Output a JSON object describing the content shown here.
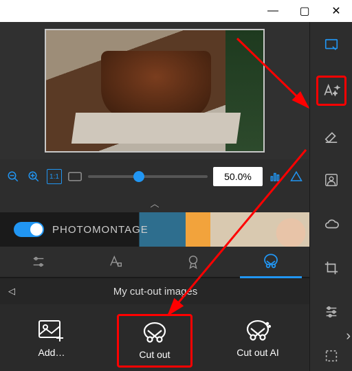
{
  "titlebar": {
    "min": "—",
    "max": "▢",
    "close": "✕"
  },
  "zoom": {
    "value": "50.0%"
  },
  "banner": {
    "label": "PHOTOMONTAGE"
  },
  "tabs": [
    {
      "name": "adjust-tab"
    },
    {
      "name": "text-tab"
    },
    {
      "name": "award-tab"
    },
    {
      "name": "cutout-tab"
    }
  ],
  "section": {
    "title": "My cut-out images"
  },
  "actions": {
    "add": "Add…",
    "cutout": "Cut out",
    "cutoutai": "Cut out AI"
  },
  "sidepanel_tools": [
    "edit",
    "text-stars",
    "eraser",
    "people",
    "cloud",
    "crop",
    "sliders",
    "select-rect"
  ]
}
